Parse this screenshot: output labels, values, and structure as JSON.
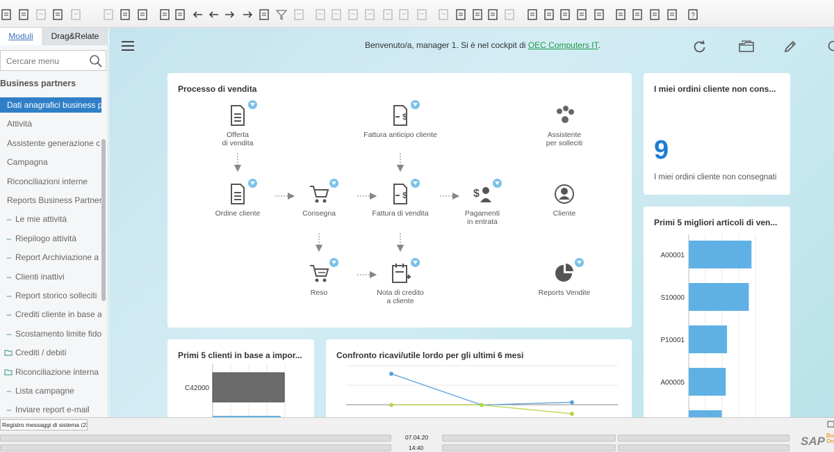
{
  "toolbar": {
    "icons": [
      "print-preview-icon",
      "email-icon",
      "export-pdf-icon",
      "printer-icon",
      "export-word-icon",
      "export-excel-icon",
      "move-icon",
      "layout-icon",
      "find-icon",
      "add-record-icon",
      "first-record-icon",
      "previous-record-icon",
      "next-record-icon",
      "last-record-icon",
      "refresh-icon",
      "filter-icon",
      "sort-icon",
      "base-document-icon",
      "target-document-icon",
      "duplicate-icon",
      "gross-profit-icon",
      "columns-icon",
      "split-icon",
      "document-view-icon",
      "edit-icon",
      "journal-entry-icon",
      "document-approval-icon",
      "message-icon",
      "chat-icon",
      "calendar-icon",
      "email-alert-icon",
      "calculator-icon",
      "org-chart-icon",
      "user-icon",
      "report-icon",
      "dashboard-icon",
      "transfer-icon",
      "sign-icon",
      "help-icon"
    ]
  },
  "sidebar": {
    "tabs": {
      "modules": "Moduli",
      "drag_relate": "Drag&Relate"
    },
    "search_placeholder": "Cercare menu",
    "section_title": "Business partners",
    "items": [
      {
        "label": "Dati anagrafici business p",
        "prefix": "",
        "active": true
      },
      {
        "label": "Attività",
        "prefix": "",
        "active": false
      },
      {
        "label": "Assistente generazione c",
        "prefix": "",
        "active": false
      },
      {
        "label": "Campagna",
        "prefix": "",
        "active": false
      },
      {
        "label": "Riconciliazioni interne",
        "prefix": "",
        "active": false
      },
      {
        "label": "Reports Business Partner",
        "prefix": "",
        "active": false
      },
      {
        "label": "Le mie attività",
        "prefix": "–",
        "active": false
      },
      {
        "label": "Riepilogo attività",
        "prefix": "–",
        "active": false
      },
      {
        "label": "Report Archiviazione a",
        "prefix": "–",
        "active": false
      },
      {
        "label": "Clienti inattivi",
        "prefix": "–",
        "active": false
      },
      {
        "label": "Report storico solleciti",
        "prefix": "–",
        "active": false
      },
      {
        "label": "Crediti cliente in base a",
        "prefix": "–",
        "active": false
      },
      {
        "label": "Scostamento limite fido",
        "prefix": "–",
        "active": false
      },
      {
        "label": "Crediti / debiti",
        "prefix": "folder",
        "active": false
      },
      {
        "label": "Riconciliazione interna",
        "prefix": "folder",
        "active": false
      },
      {
        "label": "Lista campagne",
        "prefix": "–",
        "active": false
      },
      {
        "label": "Inviare report e-mail",
        "prefix": "–",
        "active": false
      }
    ]
  },
  "header": {
    "welcome_prefix": "Benvenuto/a, manager 1. Si è nel cockpit di ",
    "company_link": "OEC Computers IT",
    "welcome_suffix": "."
  },
  "sales_process": {
    "title": "Processo di vendita",
    "nodes": [
      {
        "label": "Offerta\ndi vendita",
        "icon": "document-icon"
      },
      {
        "label": "Fattura anticipo cliente",
        "icon": "invoice-dollar-icon"
      },
      {
        "label": "Assistente\nper solleciti",
        "icon": "dunning-wizard-icon"
      },
      {
        "label": "Ordine cliente",
        "icon": "document-icon"
      },
      {
        "label": "Consegna",
        "icon": "cart-icon"
      },
      {
        "label": "Fattura di vendita",
        "icon": "invoice-dollar-icon"
      },
      {
        "label": "Pagamenti\nin entrata",
        "icon": "payment-icon"
      },
      {
        "label": "Cliente",
        "icon": "customer-icon"
      },
      {
        "label": "Reso",
        "icon": "cart-return-icon"
      },
      {
        "label": "Nota di credito\na cliente",
        "icon": "credit-note-icon"
      },
      {
        "label": "Reports Vendite",
        "icon": "pie-chart-icon"
      }
    ]
  },
  "kpi_card": {
    "title": "I miei ordini cliente non cons...",
    "value": "9",
    "label": "I miei ordini cliente non consegnati"
  },
  "top_items_card": {
    "title": "Primi 5 migliori articoli di ven...",
    "chart_data": {
      "type": "bar",
      "orientation": "horizontal",
      "categories": [
        "A00001",
        "S10000",
        "P10001",
        "A00005",
        ""
      ],
      "values": [
        95,
        91,
        58,
        56,
        50
      ],
      "color": "#5fb0e4"
    }
  },
  "top_customers_card": {
    "title": "Primi 5 clienti in base a impor...",
    "chart_data": {
      "type": "bar",
      "orientation": "horizontal",
      "categories": [
        "C42000",
        ""
      ],
      "values": [
        100,
        95
      ],
      "colors": [
        "#6b6b6b",
        "#5fb0e4"
      ]
    }
  },
  "revenue_card": {
    "title": "Confronto ricavi/utile lordo per gli ultimi 6 mesi",
    "chart_data": {
      "type": "line",
      "x": [
        1,
        2,
        3
      ],
      "series": [
        {
          "values": [
            100,
            54,
            58
          ],
          "color": "#5b9fd6"
        },
        {
          "values": [
            54,
            54,
            41
          ],
          "color": "#b6d64a"
        }
      ],
      "ylim": [
        0,
        120
      ]
    }
  },
  "statusbar": {
    "messages_log": "Registro messaggi di sistema (23)",
    "date": "07.04.20",
    "time": "14:40",
    "logo": "SAP",
    "logo_sub": "Busi\nOn"
  }
}
